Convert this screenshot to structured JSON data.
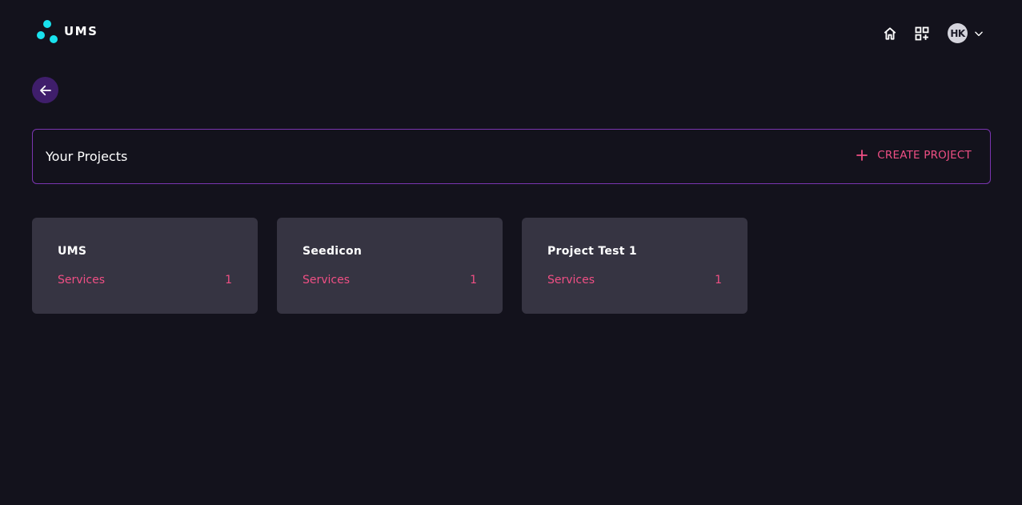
{
  "header": {
    "logo_text": "UMS",
    "avatar_initials": "HK"
  },
  "projects_bar": {
    "title": "Your Projects",
    "create_label": "CREATE PROJECT"
  },
  "projects": [
    {
      "name": "UMS",
      "services_label": "Services",
      "services_count": "1"
    },
    {
      "name": "Seedicon",
      "services_label": "Services",
      "services_count": "1"
    },
    {
      "name": "Project Test 1",
      "services_label": "Services",
      "services_count": "1"
    }
  ],
  "colors": {
    "background": "#13121c",
    "card": "#363442",
    "accent_pink": "#ef4f84",
    "logo_cyan": "#19e2ee",
    "border_purple": "#7a35b0",
    "back_button": "#3f1e6b"
  },
  "icons": {
    "logo": "logo-dots-icon",
    "home": "home-icon",
    "grid": "grid-add-icon",
    "chevron": "chevron-down-icon",
    "back": "arrow-left-icon",
    "plus": "plus-icon"
  }
}
